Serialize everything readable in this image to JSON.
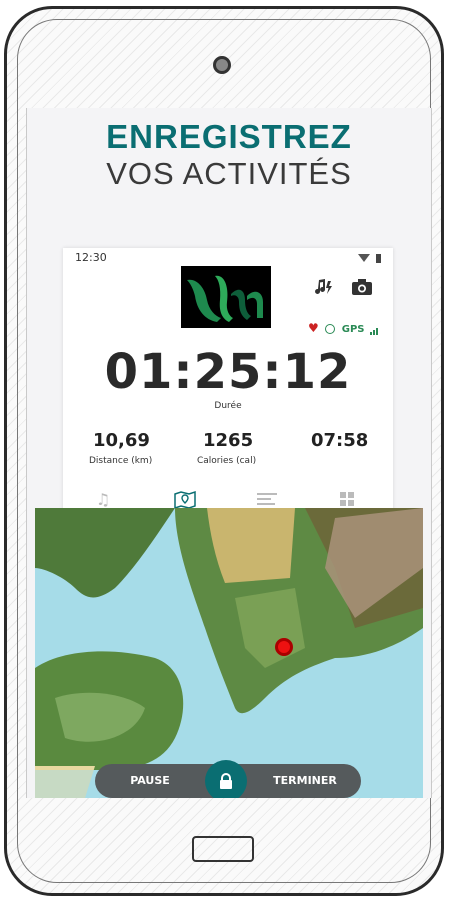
{
  "promo": {
    "line1": "ENREGISTREZ",
    "line2": "VOS ACTIVITÉS"
  },
  "statusbar": {
    "time": "12:30"
  },
  "sensors": {
    "gps_label": "GPS"
  },
  "timer": {
    "value": "01:25:12",
    "label": "Durée"
  },
  "stats": [
    {
      "value": "10,69",
      "label": "Distance (km)"
    },
    {
      "value": "1265",
      "label": "Calories (cal)"
    },
    {
      "value": "07:58",
      "label": ""
    }
  ],
  "tabs": [
    "music-icon",
    "map-icon",
    "stats-icon",
    "grid-icon"
  ],
  "controls": {
    "pause_label": "PAUSE",
    "finish_label": "TERMINER"
  },
  "colors": {
    "accent": "#0a6e72",
    "water": "#a6dce8",
    "marker": "#e11111",
    "controls_bg": "#555a5c"
  }
}
